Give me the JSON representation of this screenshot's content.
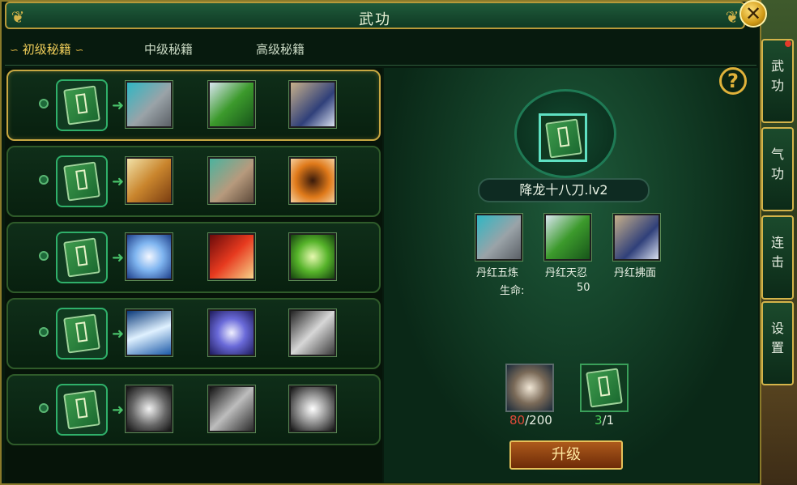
{
  "window": {
    "title": "武功"
  },
  "close_icon": "close-icon",
  "tabs": [
    {
      "label": "初级秘籍",
      "active": true
    },
    {
      "label": "中级秘籍",
      "active": false
    },
    {
      "label": "高级秘籍",
      "active": false
    }
  ],
  "skill_rows": [
    {
      "book_icon": "book-icon",
      "skills": [
        "stone-fist-icon",
        "green-blade-icon",
        "wind-sword-icon"
      ]
    },
    {
      "book_icon": "book-icon",
      "skills": [
        "golden-helm-icon",
        "stone-claw-icon",
        "fire-swirl-icon"
      ]
    },
    {
      "book_icon": "book-icon",
      "skills": [
        "blue-spirit-icon",
        "red-slash-icon",
        "green-swirl-icon"
      ]
    },
    {
      "book_icon": "book-icon",
      "skills": [
        "blue-wave-icon",
        "purple-star-icon",
        "white-rune-icon"
      ]
    },
    {
      "book_icon": "book-icon",
      "skills": [
        "white-knot-icon",
        "silver-bird-icon",
        "shatter-icon"
      ]
    }
  ],
  "detail": {
    "skill_name": "降龙十八刀.lv2",
    "sub_skills": [
      {
        "label": "丹红五炼",
        "icon": "stone-fist-icon"
      },
      {
        "label": "丹红天忍",
        "icon": "green-blade-icon"
      },
      {
        "label": "丹红拂面",
        "icon": "wind-sword-icon"
      }
    ],
    "stat_label": "生命:",
    "stat_value": "50",
    "costs": [
      {
        "icon": "scroll-fragment-icon",
        "have": "80",
        "need": "/200",
        "have_color": "#e04a3a"
      },
      {
        "icon": "book-icon",
        "have": "3",
        "need": "/1",
        "have_color": "#49d25a"
      }
    ],
    "upgrade_label": "升级"
  },
  "side_tabs": [
    "武功",
    "气功",
    "连击",
    "设置"
  ],
  "help_label": "?",
  "colors": {
    "frame_gold": "#c8a842",
    "panel_green": "#0a2817",
    "accent_orange": "#ad5a1b"
  }
}
